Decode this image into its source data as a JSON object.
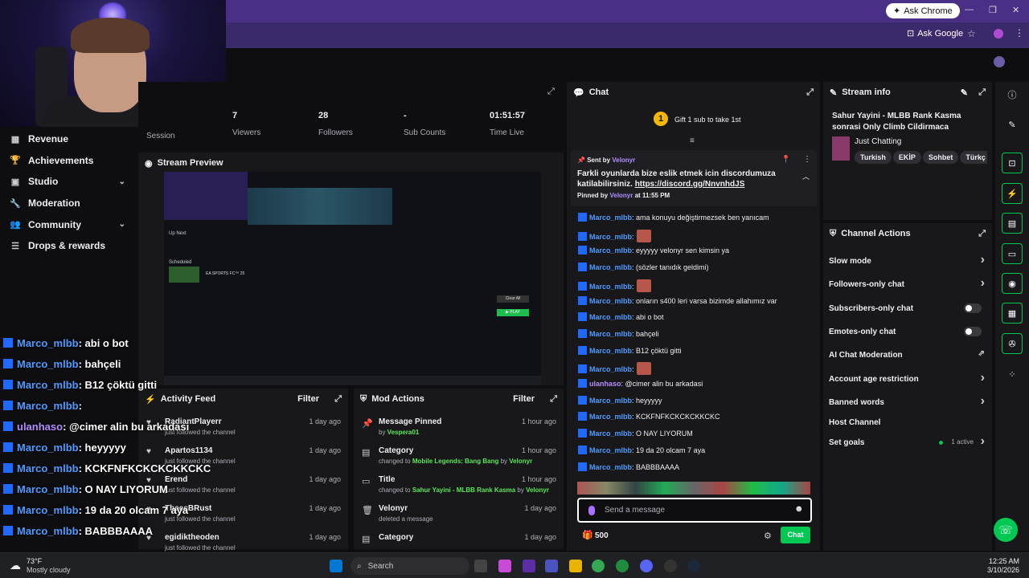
{
  "browser": {
    "ask_chrome": "Ask Chrome",
    "ask_google": "Ask Google"
  },
  "nav": {
    "items": [
      {
        "label": "Revenue",
        "icon": "revenue-icon",
        "chevron": false
      },
      {
        "label": "Achievements",
        "icon": "trophy-icon",
        "chevron": false
      },
      {
        "label": "Studio",
        "icon": "studio-icon",
        "chevron": true
      },
      {
        "label": "Moderation",
        "icon": "wrench-icon",
        "chevron": false
      },
      {
        "label": "Community",
        "icon": "people-icon",
        "chevron": true
      },
      {
        "label": "Drops & rewards",
        "icon": "drops-icon",
        "chevron": false
      }
    ]
  },
  "stats": {
    "session_label": "Session",
    "items": [
      {
        "value": "7",
        "label": "Viewers"
      },
      {
        "value": "28",
        "label": "Followers"
      },
      {
        "value": "-",
        "label": "Sub Counts"
      },
      {
        "value": "01:51:57",
        "label": "Time Live"
      }
    ]
  },
  "preview": {
    "title": "Stream Preview",
    "up_next": "Up Next",
    "scheduled": "Scheduled",
    "game": "EA SPORTS FC™ 25",
    "clear_all": "Clear All",
    "play": "▶ PLAY"
  },
  "overlay_chat": [
    {
      "user": "Marco_mlbb",
      "text": ": abi o bot",
      "alt": false
    },
    {
      "user": "Marco_mlbb",
      "text": ": bahçeli",
      "alt": false
    },
    {
      "user": "Marco_mlbb",
      "text": ": B12 çöktü gitti",
      "alt": false
    },
    {
      "user": "Marco_mlbb",
      "text": ":",
      "alt": false
    },
    {
      "user": "ulanhaso",
      "text": ": @cimer alin bu arkadasi",
      "alt": true
    },
    {
      "user": "Marco_mlbb",
      "text": ": heyyyyy",
      "alt": false
    },
    {
      "user": "Marco_mlbb",
      "text": ": KCKFNFKCKCKCKKCKC",
      "alt": false
    },
    {
      "user": "Marco_mlbb",
      "text": ": O NAY LIYORUM",
      "alt": false
    },
    {
      "user": "Marco_mlbb",
      "text": ": 19 da 20 olcam 7 aya",
      "alt": false
    },
    {
      "user": "Marco_mlbb",
      "text": ": BABBBAAAA",
      "alt": false
    }
  ],
  "activity": {
    "title": "Activity Feed",
    "filter": "Filter",
    "items": [
      {
        "name": "RadiantPlayerr",
        "sub": "just followed the channel",
        "time": "1 day ago"
      },
      {
        "name": "Apartos1134",
        "sub": "just followed the channel",
        "time": "1 day ago"
      },
      {
        "name": "Erend",
        "sub": "just followed the channel",
        "time": "1 day ago"
      },
      {
        "name": "TheesBRust",
        "sub": "just followed the channel",
        "time": "1 day ago"
      },
      {
        "name": "egidiktheoden",
        "sub": "just followed the channel",
        "time": "1 day ago"
      }
    ]
  },
  "mod": {
    "title": "Mod Actions",
    "filter": "Filter",
    "items": [
      {
        "name": "Message Pinned",
        "pre": "by ",
        "g1": "Vespera01",
        "mid": "",
        "g2": "",
        "time": "1 hour ago",
        "icon": "pin-icon"
      },
      {
        "name": "Category",
        "pre": "changed to ",
        "g1": "Mobile Legends: Bang Bang",
        "mid": " by ",
        "g2": "Velonyr",
        "time": "1 hour ago",
        "icon": "category-icon"
      },
      {
        "name": "Title",
        "pre": "changed to ",
        "g1": "Sahur Yayini - MLBB Rank Kasma",
        "mid": " by ",
        "g2": "Velonyr",
        "time": "1 hour ago",
        "icon": "title-icon"
      },
      {
        "name": "Velonyr",
        "pre": "deleted a message",
        "g1": "",
        "mid": "",
        "g2": "",
        "time": "1 day ago",
        "icon": "trash-icon"
      },
      {
        "name": "Category",
        "pre": "",
        "g1": "",
        "mid": "",
        "g2": "",
        "time": "1 day ago",
        "icon": "category-icon"
      }
    ]
  },
  "chat": {
    "title": "Chat",
    "gift_rank": "1",
    "gift_text": "Gift 1 sub to take 1st",
    "pinned": {
      "sent_by": "Sent by",
      "user": "Velonyr",
      "text": "Farkli oyunlarda bize eslik etmek icin discordumuza katilabilirsiniz.",
      "link": "https://discord.gg/NnvnhdJS",
      "pinned_by": "Pinned by",
      "pinned_at": "at 11:55 PM"
    },
    "messages": [
      {
        "user": "Marco_mlbb",
        "text": ": ama konuyu değiştirmezsek ben yanıcam",
        "emote": false,
        "alt": false
      },
      {
        "user": "Marco_mlbb",
        "text": ":",
        "emote": true,
        "alt": false
      },
      {
        "user": "Marco_mlbb",
        "text": ": eyyyyy velonyr sen kimsin ya",
        "emote": false,
        "alt": false
      },
      {
        "user": "Marco_mlbb",
        "text": ": (sözler tanıdık geldimi)",
        "emote": false,
        "alt": false
      },
      {
        "user": "Marco_mlbb",
        "text": ":",
        "emote": true,
        "alt": false
      },
      {
        "user": "Marco_mlbb",
        "text": ": onların s400 leri varsa bizimde allahımız var",
        "emote": false,
        "alt": false
      },
      {
        "user": "Marco_mlbb",
        "text": ": abi o bot",
        "emote": false,
        "alt": false
      },
      {
        "user": "Marco_mlbb",
        "text": ": bahçeli",
        "emote": false,
        "alt": false
      },
      {
        "user": "Marco_mlbb",
        "text": ": B12 çöktü gitti",
        "emote": false,
        "alt": false
      },
      {
        "user": "Marco_mlbb",
        "text": ":",
        "emote": true,
        "alt": false
      },
      {
        "user": "ulanhaso",
        "text": ": @cimer alin bu arkadasi",
        "emote": false,
        "alt": true
      },
      {
        "user": "Marco_mlbb",
        "text": ": heyyyyy",
        "emote": false,
        "alt": false
      },
      {
        "user": "Marco_mlbb",
        "text": ": KCKFNFKCKCKCKKCKC",
        "emote": false,
        "alt": false
      },
      {
        "user": "Marco_mlbb",
        "text": ": O NAY LIYORUM",
        "emote": false,
        "alt": false
      },
      {
        "user": "Marco_mlbb",
        "text": ": 19 da 20 olcam 7 aya",
        "emote": false,
        "alt": false
      },
      {
        "user": "Marco_mlbb",
        "text": ": BABBBAAAA",
        "emote": false,
        "alt": false
      }
    ],
    "placeholder": "Send a message",
    "points": "500",
    "send": "Chat"
  },
  "stream_info": {
    "title": "Stream info",
    "stream_title": "Sahur Yayini - MLBB Rank Kasma sonrasi Only Climb Cildirmaca",
    "category": "Just Chatting",
    "tags": [
      "Turkish",
      "EKİP",
      "Sohbet",
      "Türkç"
    ]
  },
  "channel_actions": {
    "title": "Channel Actions",
    "items": [
      {
        "label": "Slow mode",
        "kind": "arrow"
      },
      {
        "label": "Followers-only chat",
        "kind": "arrow"
      },
      {
        "label": "Subscribers-only chat",
        "kind": "toggle"
      },
      {
        "label": "Emotes-only chat",
        "kind": "toggle"
      },
      {
        "label": "AI Chat Moderation",
        "kind": "external"
      },
      {
        "label": "Account age restriction",
        "kind": "arrow"
      },
      {
        "label": "Banned words",
        "kind": "arrow"
      },
      {
        "label": "Host Channel",
        "kind": "none"
      },
      {
        "label": "Set goals",
        "kind": "arrow",
        "extra": "1 active"
      }
    ]
  },
  "taskbar": {
    "weather_temp": "73°F",
    "weather_text": "Mostly cloudy",
    "search": "Search",
    "time": "12:25 AM",
    "date": "3/10/2026"
  },
  "colors": {
    "accent": "#9147ff",
    "green": "#00c853",
    "link": "#4d9cff"
  }
}
